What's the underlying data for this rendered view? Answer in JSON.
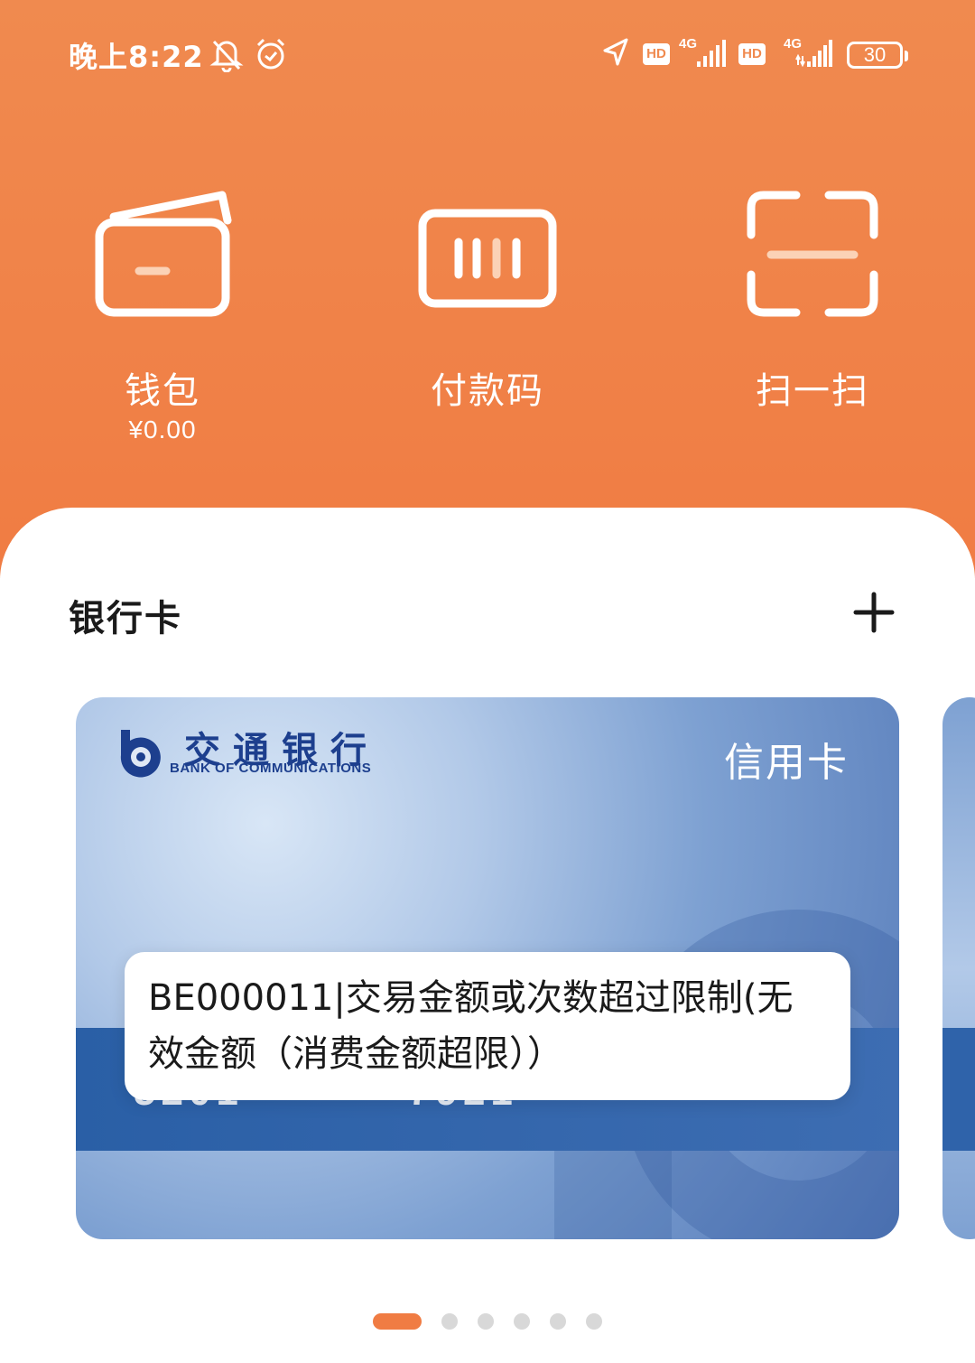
{
  "status_bar": {
    "time": "晚上8:22",
    "hd_1": "HD",
    "hd_2": "HD",
    "net_1": "4G",
    "net_2": "4G",
    "battery": "30"
  },
  "quick_actions": [
    {
      "label": "钱包",
      "sub": "¥0.00",
      "icon": "wallet-icon"
    },
    {
      "label": "付款码",
      "sub": "",
      "icon": "barcode-icon"
    },
    {
      "label": "扫一扫",
      "sub": "",
      "icon": "scan-icon"
    }
  ],
  "bank_section": {
    "title": "银行卡",
    "add_icon": "plus-icon"
  },
  "card": {
    "bank_name_cn": "交通银行",
    "bank_name_en": "BANK OF COMMUNICATIONS",
    "card_type": "信用卡",
    "number_left": "5201",
    "number_right": "7921"
  },
  "toast": {
    "message": "BE000011|交易金额或次数超过限制(无效金额（消费金额超限））"
  },
  "pager": {
    "count": 6,
    "active_index": 0
  },
  "colors": {
    "accent": "#f07c43",
    "card_blue": "#2a5fa6",
    "bank_navy": "#1d3f8e"
  }
}
